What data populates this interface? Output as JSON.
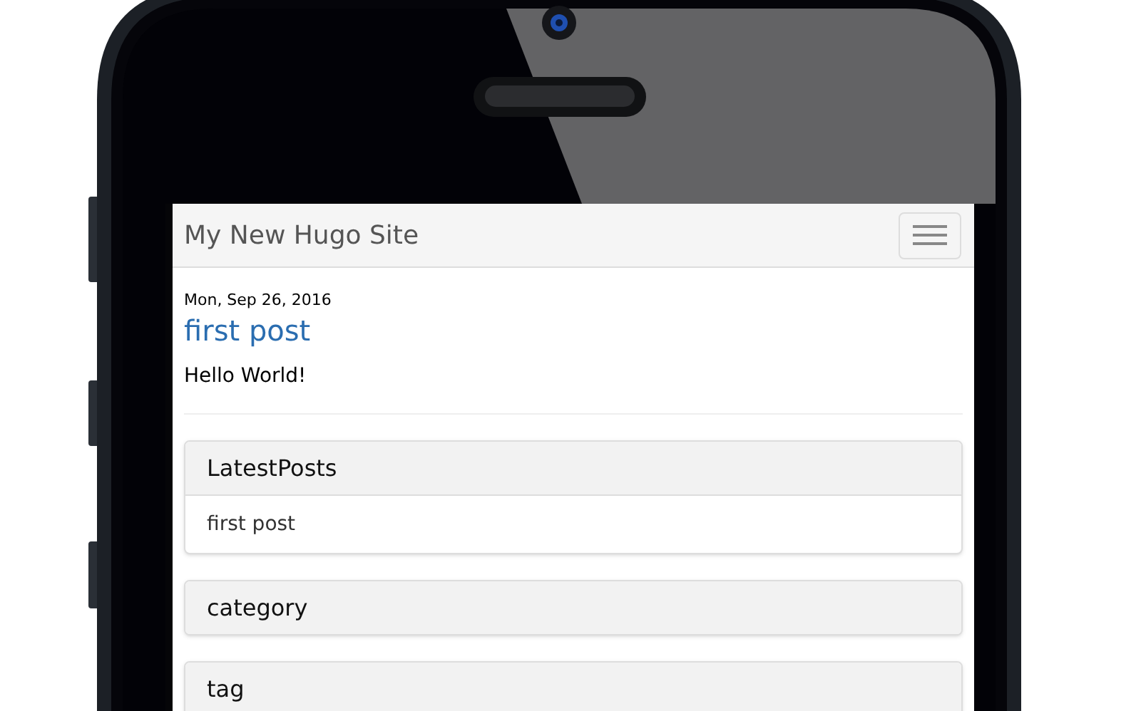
{
  "navbar": {
    "title": "My New Hugo Site"
  },
  "posts": [
    {
      "date": "Mon, Sep 26, 2016",
      "title": "first post",
      "body": "Hello World!"
    }
  ],
  "sidebar": {
    "panels": [
      {
        "heading": "LatestPosts",
        "items": [
          "first post"
        ]
      },
      {
        "heading": "category"
      },
      {
        "heading": "tag"
      }
    ]
  }
}
